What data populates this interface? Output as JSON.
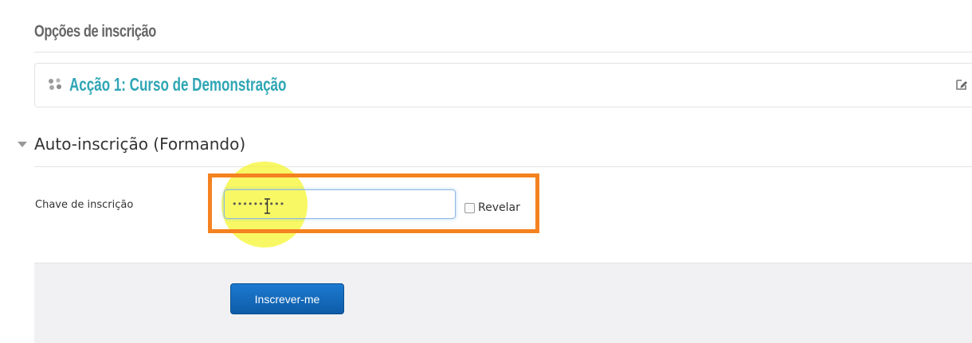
{
  "enrolment_options": {
    "title": "Opções de inscrição"
  },
  "course": {
    "icon": "course-plugin-icon",
    "name": "Acção 1: Curso de Demonstração",
    "edit_icon": "edit-summary-icon"
  },
  "self_enrolment": {
    "legend": "Auto-inscrição (Formando)",
    "collapse_icon": "triangle-down-icon",
    "key_label": "Chave de inscrição",
    "key_value": "••••••••••",
    "reveal_label": "Revelar",
    "reveal_checked": false,
    "submit_label": "Inscrever-me"
  },
  "annotation": {
    "highlight_color": "#f5f528",
    "box_color": "#f58220"
  },
  "colors": {
    "course_link": "#2fa6b5",
    "button": "#1566b8",
    "focus_border": "#8fb8e6"
  }
}
